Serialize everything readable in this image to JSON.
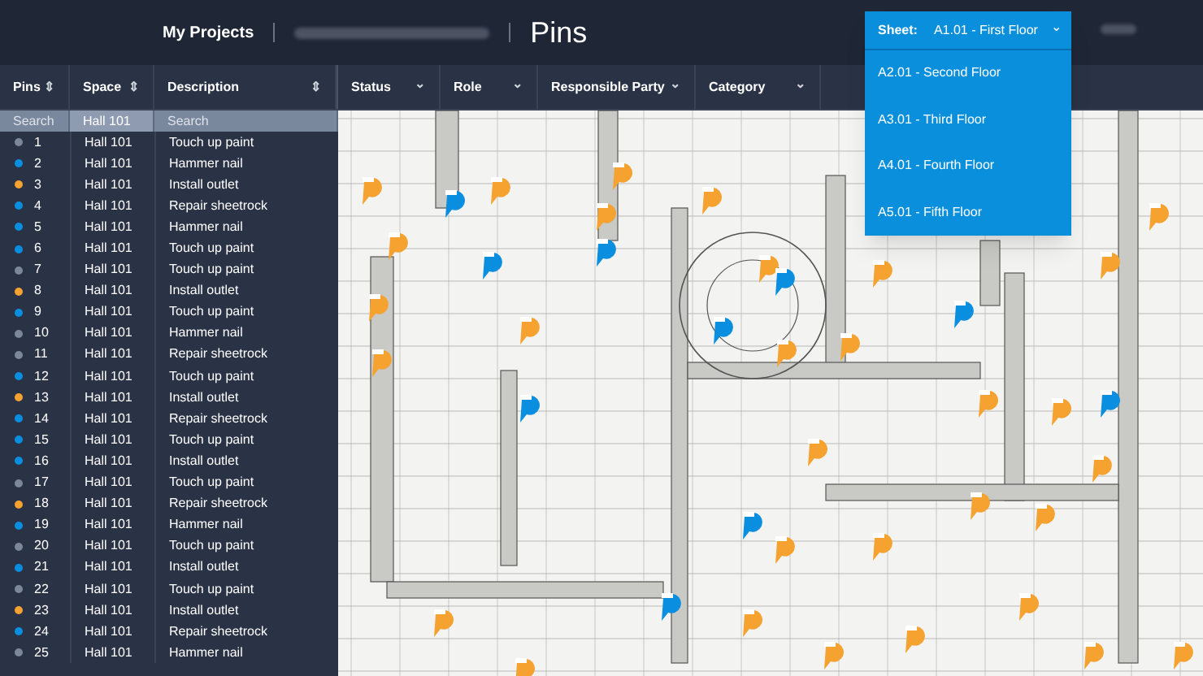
{
  "nav": {
    "link": "My Projects",
    "page_title": "Pins"
  },
  "sheet_selector": {
    "label": "Sheet:",
    "value": "A1.01 - First Floor",
    "caret": "⌄",
    "expanded": true,
    "options": [
      "A2.01 - Second Floor",
      "A3.01 - Third Floor",
      "A4.01 - Fourth Floor",
      "A5.01 - Fifth Floor"
    ]
  },
  "table": {
    "columns": [
      {
        "label": "Pins",
        "sort": "⇕"
      },
      {
        "label": "Space",
        "sort": "⇕"
      },
      {
        "label": "Description",
        "sort": "⇕"
      }
    ],
    "search": [
      {
        "placeholder": "Search"
      },
      {
        "value": "Hall 101"
      },
      {
        "placeholder": "Search"
      }
    ],
    "rows": [
      {
        "pin": "1",
        "space": "Hall 101",
        "description": "Touch up paint",
        "color": "#7c8797"
      },
      {
        "pin": "2",
        "space": "Hall 101",
        "description": "Hammer nail",
        "color": "#0a8fe0"
      },
      {
        "pin": "3",
        "space": "Hall 101",
        "description": "Install outlet",
        "color": "#f5a230"
      },
      {
        "pin": "4",
        "space": "Hall 101",
        "description": "Repair sheetrock",
        "color": "#0a8fe0"
      },
      {
        "pin": "5",
        "space": "Hall 101",
        "description": "Hammer nail",
        "color": "#0a8fe0"
      },
      {
        "pin": "6",
        "space": "Hall 101",
        "description": "Touch up paint",
        "color": "#0a8fe0"
      },
      {
        "pin": "7",
        "space": "Hall 101",
        "description": "Touch up paint",
        "color": "#7c8797"
      },
      {
        "pin": "8",
        "space": "Hall 101",
        "description": "Install outlet",
        "color": "#f5a230"
      },
      {
        "pin": "9",
        "space": "Hall 101",
        "description": "Touch up paint",
        "color": "#0a8fe0"
      },
      {
        "pin": "10",
        "space": "Hall 101",
        "description": "Hammer nail",
        "color": "#7c8797"
      },
      {
        "pin": "11",
        "space": "Hall 101",
        "description": "Repair sheetrock",
        "color": "#7c8797"
      },
      {
        "pin": "12",
        "space": "Hall 101",
        "description": "Touch up paint",
        "color": "#0a8fe0"
      },
      {
        "pin": "13",
        "space": "Hall 101",
        "description": "Install outlet",
        "color": "#f5a230"
      },
      {
        "pin": "14",
        "space": "Hall 101",
        "description": "Repair sheetrock",
        "color": "#0a8fe0"
      },
      {
        "pin": "15",
        "space": "Hall 101",
        "description": "Touch up paint",
        "color": "#0a8fe0"
      },
      {
        "pin": "16",
        "space": "Hall 101",
        "description": "Install outlet",
        "color": "#0a8fe0"
      },
      {
        "pin": "17",
        "space": "Hall 101",
        "description": "Touch up paint",
        "color": "#7c8797"
      },
      {
        "pin": "18",
        "space": "Hall 101",
        "description": "Repair sheetrock",
        "color": "#f5a230"
      },
      {
        "pin": "19",
        "space": "Hall 101",
        "description": "Hammer nail",
        "color": "#0a8fe0"
      },
      {
        "pin": "20",
        "space": "Hall 101",
        "description": "Touch up paint",
        "color": "#7c8797"
      },
      {
        "pin": "21",
        "space": "Hall 101",
        "description": "Install outlet",
        "color": "#0a8fe0"
      },
      {
        "pin": "22",
        "space": "Hall 101",
        "description": "Touch up paint",
        "color": "#7c8797"
      },
      {
        "pin": "23",
        "space": "Hall 101",
        "description": "Install outlet",
        "color": "#f5a230"
      },
      {
        "pin": "24",
        "space": "Hall 101",
        "description": "Repair sheetrock",
        "color": "#0a8fe0"
      },
      {
        "pin": "25",
        "space": "Hall 101",
        "description": "Hammer nail",
        "color": "#7c8797"
      }
    ]
  },
  "filters": [
    {
      "label": "Status",
      "caret": "⌄"
    },
    {
      "label": "Role",
      "caret": "⌄"
    },
    {
      "label": "Responsible Party",
      "caret": "⌄"
    },
    {
      "label": "Category",
      "caret": "⌄"
    }
  ]
}
